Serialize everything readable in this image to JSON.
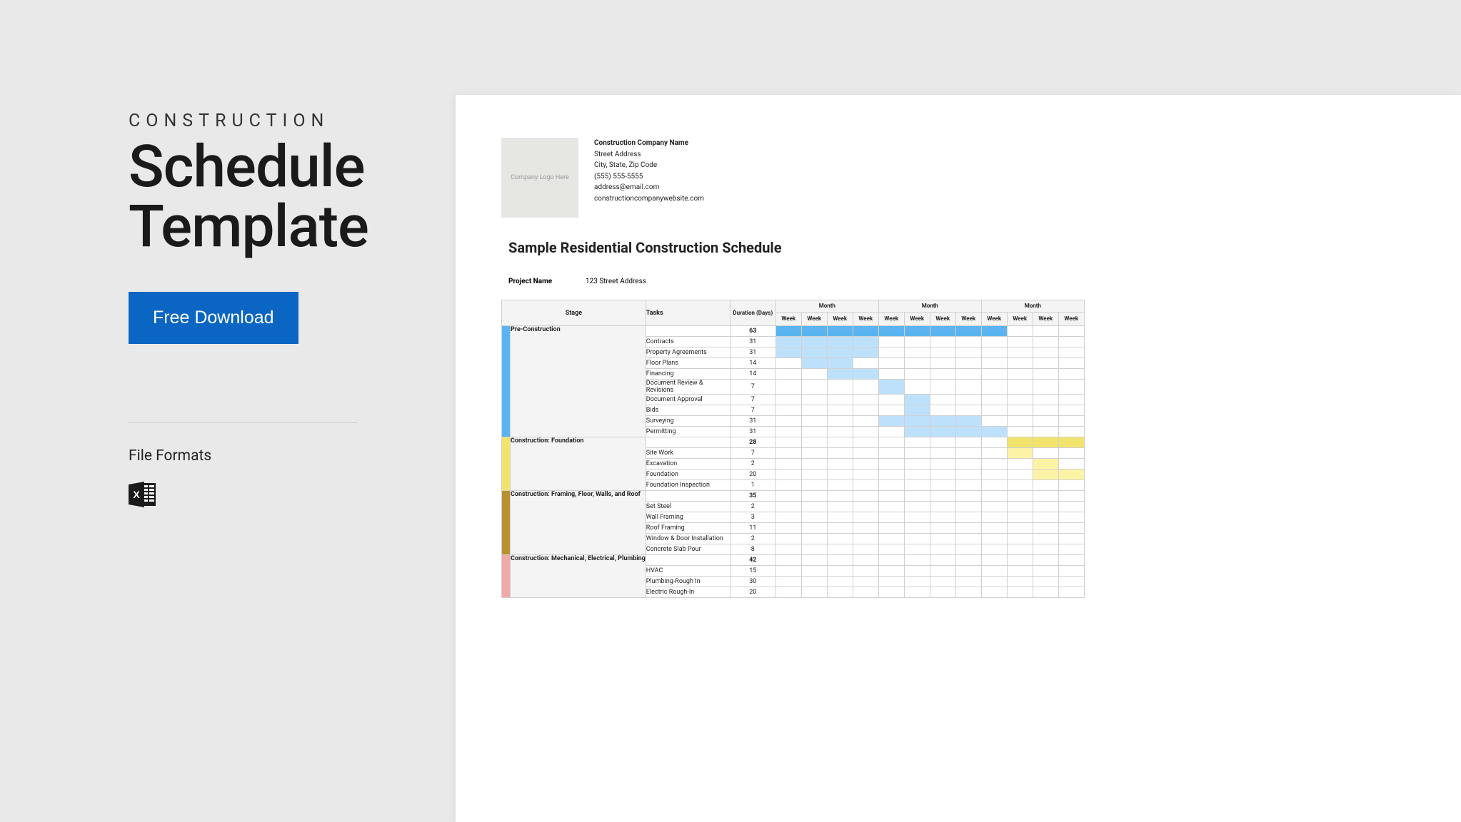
{
  "left": {
    "eyebrow": "CONSTRUCTION",
    "title_line1": "Schedule",
    "title_line2": "Template",
    "download_label": "Free Download",
    "file_formats_label": "File Formats"
  },
  "doc": {
    "logo_placeholder": "Company Logo Here",
    "company": {
      "name": "Construction Company Name",
      "street": "Street Address",
      "city": "City, State, Zip Code",
      "phone": "(555) 555-5555",
      "email": "address@email.com",
      "website": "constructioncompanywebsite.com"
    },
    "title": "Sample Residential Construction Schedule",
    "project_label": "Project Name",
    "project_value": "123 Street Address",
    "headers": {
      "stage": "Stage",
      "tasks": "Tasks",
      "duration": "Duration (Days)",
      "month": "Month",
      "week": "Week"
    },
    "stages": [
      {
        "name": "Pre-Construction",
        "color": "#5bb4f0",
        "duration": 63,
        "tasks": [
          {
            "name": "Contracts",
            "duration": 31,
            "bars": [
              {
                "start": 0,
                "len": 4,
                "color": "#bee1fb"
              }
            ]
          },
          {
            "name": "Property Agreements",
            "duration": 31,
            "bars": [
              {
                "start": 0,
                "len": 4,
                "color": "#bee1fb"
              }
            ]
          },
          {
            "name": "Floor Plans",
            "duration": 14,
            "bars": [
              {
                "start": 1,
                "len": 2,
                "color": "#bee1fb"
              }
            ]
          },
          {
            "name": "Financing",
            "duration": 14,
            "bars": [
              {
                "start": 2,
                "len": 2,
                "color": "#bee1fb"
              }
            ]
          },
          {
            "name": "Document Review & Revisions",
            "duration": 7,
            "bars": [
              {
                "start": 4,
                "len": 1,
                "color": "#bee1fb"
              }
            ]
          },
          {
            "name": "Document Approval",
            "duration": 7,
            "bars": [
              {
                "start": 5,
                "len": 1,
                "color": "#bee1fb"
              }
            ]
          },
          {
            "name": "Bids",
            "duration": 7,
            "bars": [
              {
                "start": 5,
                "len": 1,
                "color": "#bee1fb"
              }
            ]
          },
          {
            "name": "Surveying",
            "duration": 31,
            "bars": [
              {
                "start": 4,
                "len": 4,
                "color": "#bee1fb"
              }
            ]
          },
          {
            "name": "Permitting",
            "duration": 31,
            "bars": [
              {
                "start": 5,
                "len": 4,
                "color": "#bee1fb"
              }
            ]
          }
        ],
        "stage_bar": {
          "start": 0,
          "len": 9,
          "color": "#5bb4f0"
        }
      },
      {
        "name": "Construction: Foundation",
        "color": "#f1e36c",
        "duration": 28,
        "tasks": [
          {
            "name": "Site Work",
            "duration": 7,
            "bars": [
              {
                "start": 9,
                "len": 1,
                "color": "#fdf3a6"
              }
            ]
          },
          {
            "name": "Excavation",
            "duration": 2,
            "bars": [
              {
                "start": 10,
                "len": 1,
                "color": "#fdf3a6"
              }
            ]
          },
          {
            "name": "Foundation",
            "duration": 20,
            "bars": [
              {
                "start": 10,
                "len": 2,
                "color": "#fdf3a6"
              }
            ]
          },
          {
            "name": "Foundation Inspection",
            "duration": 1,
            "bars": [
              {
                "start": 12,
                "len": 1,
                "color": "#fdf3a6"
              }
            ]
          }
        ],
        "stage_bar": {
          "start": 9,
          "len": 4,
          "color": "#f1e36c"
        }
      },
      {
        "name": "Construction: Framing, Floor, Walls, and Roof",
        "color": "#b8922f",
        "duration": 35,
        "tasks": [
          {
            "name": "Set Steel",
            "duration": 2,
            "bars": []
          },
          {
            "name": "Wall Framing",
            "duration": 3,
            "bars": []
          },
          {
            "name": "Roof Framing",
            "duration": 11,
            "bars": []
          },
          {
            "name": "Window & Door Installation",
            "duration": 2,
            "bars": []
          },
          {
            "name": "Concrete Slab Pour",
            "duration": 8,
            "bars": []
          }
        ],
        "stage_bar": null
      },
      {
        "name": "Construction: Mechanical, Electrical, Plumbing",
        "color": "#f0a9a9",
        "duration": 42,
        "tasks": [
          {
            "name": "HVAC",
            "duration": 15,
            "bars": []
          },
          {
            "name": "Plumbing-Rough In",
            "duration": 30,
            "bars": []
          },
          {
            "name": "Electric Rough-In",
            "duration": 20,
            "bars": []
          }
        ],
        "stage_bar": null
      }
    ],
    "months_visible": 3,
    "weeks_per_month": 4
  }
}
